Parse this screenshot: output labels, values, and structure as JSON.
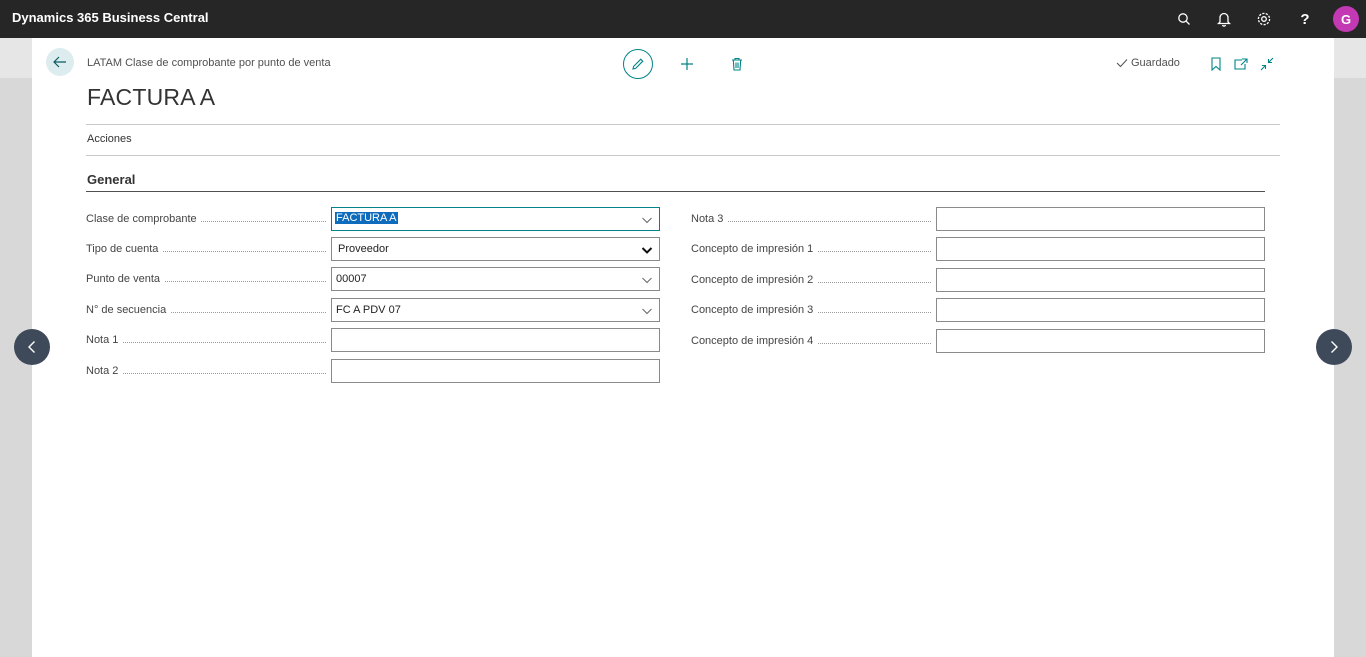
{
  "app": {
    "title": "Dynamics 365 Business Central",
    "avatar_initial": "G"
  },
  "topbar_icons": [
    "search-icon",
    "bell-icon",
    "gear-icon",
    "help-icon"
  ],
  "topbar_help_glyph": "?",
  "page": {
    "breadcrumb": "LATAM Clase de comprobante por punto de venta",
    "title": "FACTURA A",
    "status": "Guardado",
    "actions_menu": "Acciones",
    "section": "General"
  },
  "fields_left": [
    {
      "label": "Clase de comprobante",
      "value": "FACTURA A",
      "kind": "combo"
    },
    {
      "label": "Tipo de cuenta",
      "value": "Proveedor",
      "kind": "select"
    },
    {
      "label": "Punto de venta",
      "value": "00007",
      "kind": "combo"
    },
    {
      "label": "N° de secuencia",
      "value": "FC A PDV 07",
      "kind": "combo"
    },
    {
      "label": "Nota 1",
      "value": "",
      "kind": "text"
    },
    {
      "label": "Nota 2",
      "value": "",
      "kind": "text"
    }
  ],
  "fields_right": [
    {
      "label": "Nota 3",
      "value": "",
      "kind": "text"
    },
    {
      "label": "Concepto de impresión 1",
      "value": "",
      "kind": "text"
    },
    {
      "label": "Concepto de impresión 2",
      "value": "",
      "kind": "text"
    },
    {
      "label": "Concepto de impresión 3",
      "value": "",
      "kind": "text"
    },
    {
      "label": "Concepto de impresión 4",
      "value": "",
      "kind": "text"
    }
  ],
  "colors": {
    "accent": "#008489",
    "topbar": "#262626",
    "avatar": "#c239b3",
    "selection": "#0f6cbd"
  }
}
